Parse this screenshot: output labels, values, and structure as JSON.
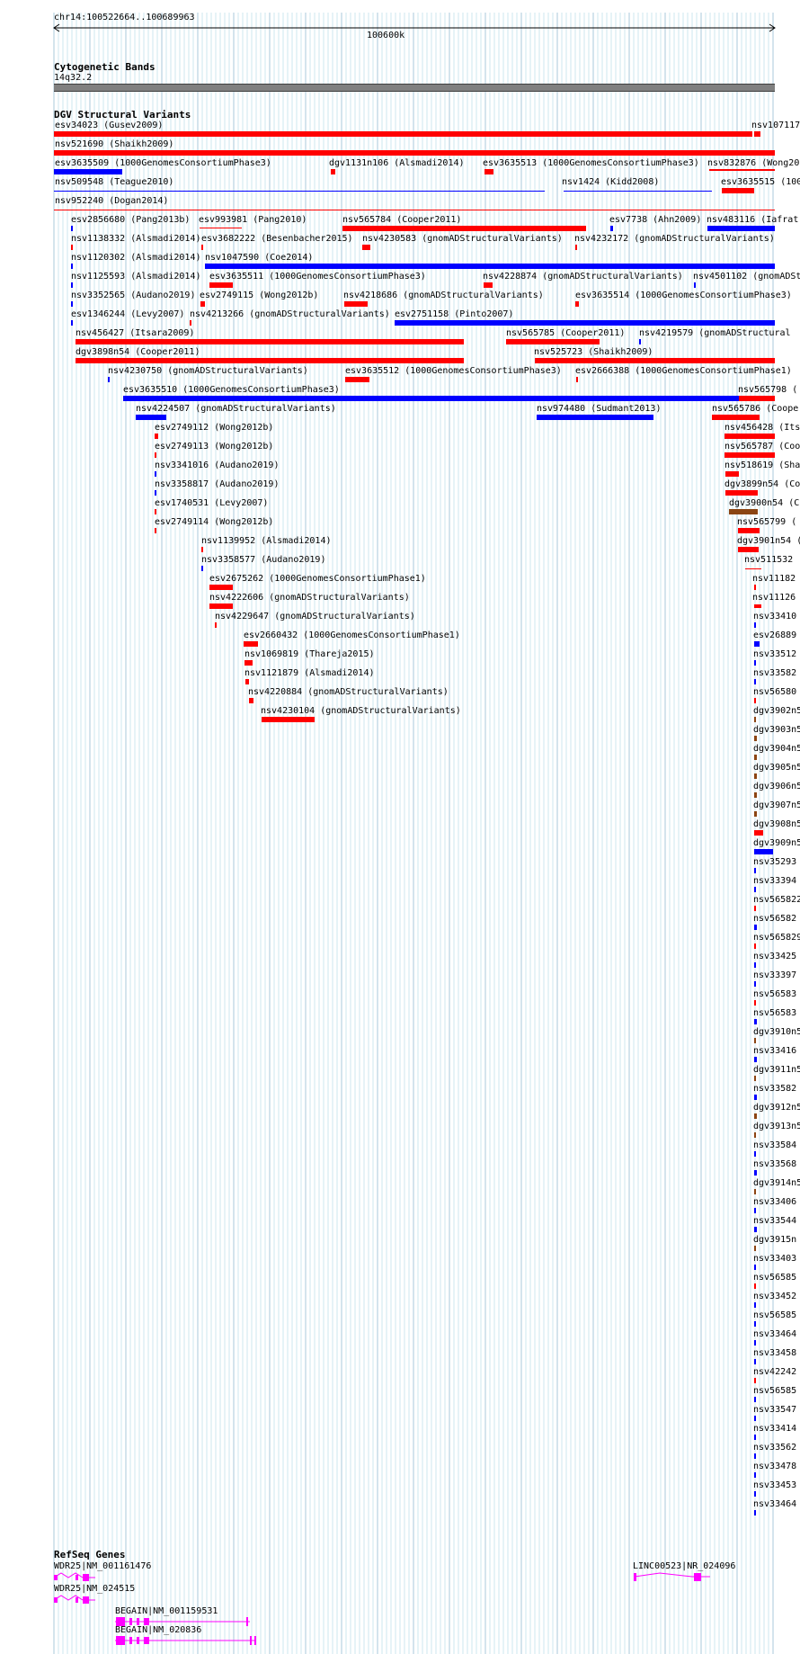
{
  "ruler": {
    "coord": "chr14:100522664..100689963",
    "tick_label": "100600k"
  },
  "cytoband": {
    "title": "Cytogenetic Bands",
    "band": "14q32.2"
  },
  "dgv": {
    "title": "DGV Structural Variants"
  },
  "refseq": {
    "title": "RefSeq Genes"
  },
  "colors": {
    "loss": "#ff0000",
    "gain": "#0000ff",
    "complex": "#8b4513",
    "isoform": "#ff00ff",
    "grid": "#add8e6"
  },
  "variants": [
    {
      "label": "esv34023 (Gusev2009)",
      "c": "loss"
    },
    {
      "label": "nsv107117",
      "c": "loss"
    },
    {
      "label": "nsv521690 (Shaikh2009)",
      "c": "loss"
    },
    {
      "label": "esv3635509 (1000GenomesConsortiumPhase3)",
      "c": "gain"
    },
    {
      "label": "dgv1131n106 (Alsmadi2014)",
      "c": "loss"
    },
    {
      "label": "esv3635513 (1000GenomesConsortiumPhase3)",
      "c": "loss"
    },
    {
      "label": "nsv832876 (Wong20",
      "c": "loss"
    },
    {
      "label": "nsv509548 (Teague2010)",
      "c": "gain"
    },
    {
      "label": "nsv1424 (Kidd2008)",
      "c": "gain"
    },
    {
      "label": "esv3635515 (100",
      "c": "loss"
    },
    {
      "label": "nsv952240 (Dogan2014)",
      "c": "loss"
    },
    {
      "label": "esv2856680 (Pang2013b)",
      "c": "gain"
    },
    {
      "label": "esv993981 (Pang2010)",
      "c": "loss"
    },
    {
      "label": "nsv565784 (Cooper2011)",
      "c": "loss"
    },
    {
      "label": "esv7738 (Ahn2009)",
      "c": "gain"
    },
    {
      "label": "nsv483116 (Iafrat",
      "c": "gain"
    },
    {
      "label": "nsv1138332 (Alsmadi2014)",
      "c": "loss"
    },
    {
      "label": "esv3682222 (Besenbacher2015)",
      "c": "loss"
    },
    {
      "label": "nsv4230583 (gnomADStructuralVariants)",
      "c": "loss"
    },
    {
      "label": "nsv4232172 (gnomADStructuralVariants)",
      "c": "loss"
    },
    {
      "label": "nsv1120302 (Alsmadi2014)",
      "c": "gain"
    },
    {
      "label": "nsv1047590 (Coe2014)",
      "c": "gain"
    },
    {
      "label": "nsv1125593 (Alsmadi2014)",
      "c": "gain"
    },
    {
      "label": "esv3635511 (1000GenomesConsortiumPhase3)",
      "c": "loss"
    },
    {
      "label": "nsv4228874 (gnomADStructuralVariants)",
      "c": "loss"
    },
    {
      "label": "nsv4501102 (gnomADSt",
      "c": "gain"
    },
    {
      "label": "nsv3352565 (Audano2019)",
      "c": "gain"
    },
    {
      "label": "esv2749115 (Wong2012b)",
      "c": "loss"
    },
    {
      "label": "nsv4218686 (gnomADStructuralVariants)",
      "c": "loss"
    },
    {
      "label": "esv3635514 (1000GenomesConsortiumPhase3)",
      "c": "loss"
    },
    {
      "label": "esv1346244 (Levy2007)",
      "c": "gain"
    },
    {
      "label": "nsv4213266 (gnomADStructuralVariants)",
      "c": "loss"
    },
    {
      "label": "esv2751158 (Pinto2007)",
      "c": "gain"
    },
    {
      "label": "nsv456427 (Itsara2009)",
      "c": "loss"
    },
    {
      "label": "nsv565785 (Cooper2011)",
      "c": "loss"
    },
    {
      "label": "nsv4219579 (gnomADStructural",
      "c": "gain"
    },
    {
      "label": "dgv3898n54 (Cooper2011)",
      "c": "loss"
    },
    {
      "label": "nsv525723 (Shaikh2009)",
      "c": "loss"
    },
    {
      "label": "nsv4230750 (gnomADStructuralVariants)",
      "c": "gain"
    },
    {
      "label": "esv3635512 (1000GenomesConsortiumPhase3)",
      "c": "loss"
    },
    {
      "label": "esv2666388 (1000GenomesConsortiumPhase1)",
      "c": "loss"
    },
    {
      "label": "esv3635510 (1000GenomesConsortiumPhase3)",
      "c": "gain"
    },
    {
      "label": "nsv565798 (",
      "c": "loss"
    },
    {
      "label": "nsv4224507 (gnomADStructuralVariants)",
      "c": "gain"
    },
    {
      "label": "nsv974480 (Sudmant2013)",
      "c": "gain"
    },
    {
      "label": "nsv565786 (Cooper",
      "c": "loss"
    },
    {
      "label": "esv2749112 (Wong2012b)",
      "c": "loss"
    },
    {
      "label": "nsv456428 (Its",
      "c": "loss"
    },
    {
      "label": "esv2749113 (Wong2012b)",
      "c": "loss"
    },
    {
      "label": "nsv565787 (Coo",
      "c": "loss"
    },
    {
      "label": "nsv3341016 (Audano2019)",
      "c": "gain"
    },
    {
      "label": "nsv518619 (Sha",
      "c": "loss"
    },
    {
      "label": "nsv3358817 (Audano2019)",
      "c": "gain"
    },
    {
      "label": "dgv3899n54 (Co",
      "c": "loss"
    },
    {
      "label": "esv1740531 (Levy2007)",
      "c": "loss"
    },
    {
      "label": "dgv3900n54 (C",
      "c": "complex"
    },
    {
      "label": "esv2749114 (Wong2012b)",
      "c": "loss"
    },
    {
      "label": "nsv565799 (",
      "c": "loss"
    },
    {
      "label": "nsv1139952 (Alsmadi2014)",
      "c": "loss"
    },
    {
      "label": "dgv3901n54 (",
      "c": "loss"
    },
    {
      "label": "nsv3358577 (Audano2019)",
      "c": "gain"
    },
    {
      "label": "nsv511532 (",
      "c": "loss"
    },
    {
      "label": "esv2675262 (1000GenomesConsortiumPhase1)",
      "c": "loss"
    },
    {
      "label": "nsv11182",
      "c": "loss"
    },
    {
      "label": "nsv4222606 (gnomADStructuralVariants)",
      "c": "loss"
    },
    {
      "label": "nsv11126",
      "c": "loss"
    },
    {
      "label": "nsv4229647 (gnomADStructuralVariants)",
      "c": "loss"
    },
    {
      "label": "nsv33410",
      "c": "gain"
    },
    {
      "label": "esv2660432 (1000GenomesConsortiumPhase1)",
      "c": "loss"
    },
    {
      "label": "esv26889",
      "c": "gain"
    },
    {
      "label": "nsv1069819 (Thareja2015)",
      "c": "loss"
    },
    {
      "label": "nsv33512",
      "c": "gain"
    },
    {
      "label": "nsv1121879 (Alsmadi2014)",
      "c": "loss"
    },
    {
      "label": "nsv33582",
      "c": "gain"
    },
    {
      "label": "nsv4220884 (gnomADStructuralVariants)",
      "c": "loss"
    },
    {
      "label": "nsv56580",
      "c": "loss"
    },
    {
      "label": "nsv4230104 (gnomADStructuralVariants)",
      "c": "loss"
    },
    {
      "label": "dgv3902n5",
      "c": "complex"
    },
    {
      "label": "dgv3903n5",
      "c": "complex"
    },
    {
      "label": "dgv3904n5",
      "c": "complex"
    },
    {
      "label": "dgv3905n5",
      "c": "complex"
    },
    {
      "label": "dgv3906n5",
      "c": "complex"
    },
    {
      "label": "dgv3907n5",
      "c": "complex"
    },
    {
      "label": "dgv3908n5",
      "c": "loss"
    },
    {
      "label": "dgv3909n5",
      "c": "gain"
    },
    {
      "label": "nsv35293",
      "c": "gain"
    },
    {
      "label": "nsv33394",
      "c": "gain"
    },
    {
      "label": "nsv565822",
      "c": "loss"
    },
    {
      "label": "nsv56582",
      "c": "gain"
    },
    {
      "label": "nsv565829",
      "c": "loss"
    },
    {
      "label": "nsv33425",
      "c": "gain"
    },
    {
      "label": "nsv33397",
      "c": "gain"
    },
    {
      "label": "nsv56583",
      "c": "loss"
    },
    {
      "label": "nsv56583",
      "c": "gain"
    },
    {
      "label": "dgv3910n5",
      "c": "complex"
    },
    {
      "label": "nsv33416",
      "c": "gain"
    },
    {
      "label": "dgv3911n5",
      "c": "complex"
    },
    {
      "label": "nsv33582",
      "c": "gain"
    },
    {
      "label": "dgv3912n5",
      "c": "complex"
    },
    {
      "label": "dgv3913n5",
      "c": "complex"
    },
    {
      "label": "nsv33584",
      "c": "gain"
    },
    {
      "label": "nsv33568",
      "c": "gain"
    },
    {
      "label": "dgv3914n5",
      "c": "complex"
    },
    {
      "label": "nsv33406",
      "c": "gain"
    },
    {
      "label": "nsv33544",
      "c": "gain"
    },
    {
      "label": "dgv3915n",
      "c": "complex"
    },
    {
      "label": "nsv33403",
      "c": "gain"
    },
    {
      "label": "nsv56585",
      "c": "loss"
    },
    {
      "label": "nsv33452",
      "c": "gain"
    },
    {
      "label": "nsv56585",
      "c": "gain"
    },
    {
      "label": "nsv33464",
      "c": "gain"
    },
    {
      "label": "nsv33458",
      "c": "gain"
    },
    {
      "label": "nsv42242",
      "c": "loss"
    },
    {
      "label": "nsv56585",
      "c": "gain"
    },
    {
      "label": "nsv33547",
      "c": "gain"
    },
    {
      "label": "nsv33414",
      "c": "gain"
    },
    {
      "label": "nsv33562",
      "c": "gain"
    },
    {
      "label": "nsv33478",
      "c": "gain"
    },
    {
      "label": "nsv33453",
      "c": "gain"
    },
    {
      "label": "nsv33464",
      "c": "gain"
    }
  ],
  "genes": [
    {
      "label": "WDR25|NM_001161476"
    },
    {
      "label": "WDR25|NM_024515"
    },
    {
      "label": "BEGAIN|NM_001159531"
    },
    {
      "label": "BEGAIN|NM_020836"
    },
    {
      "label": "LINC00523|NR_024096"
    }
  ]
}
